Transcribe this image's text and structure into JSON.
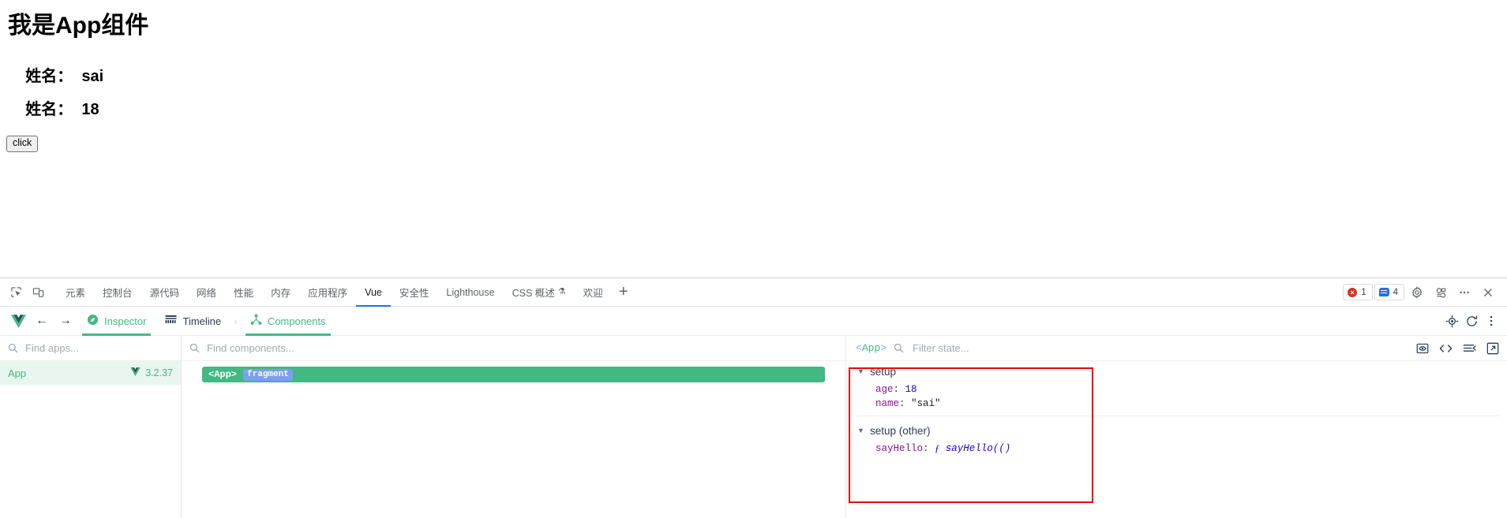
{
  "page": {
    "heading": "我是App组件",
    "rows": [
      {
        "label": "姓名：",
        "value": "sai"
      },
      {
        "label": "姓名：",
        "value": "18"
      }
    ],
    "button_label": "click"
  },
  "devtools": {
    "left_icons": [
      {
        "name": "inspect-element-icon"
      },
      {
        "name": "device-toolbar-icon"
      }
    ],
    "tabs": [
      {
        "label": "元素",
        "active": false
      },
      {
        "label": "控制台",
        "active": false
      },
      {
        "label": "源代码",
        "active": false
      },
      {
        "label": "网络",
        "active": false
      },
      {
        "label": "性能",
        "active": false
      },
      {
        "label": "内存",
        "active": false
      },
      {
        "label": "应用程序",
        "active": false
      },
      {
        "label": "Vue",
        "active": true
      },
      {
        "label": "安全性",
        "active": false
      },
      {
        "label": "Lighthouse",
        "active": false
      },
      {
        "label": "CSS 概述",
        "active": false,
        "flask": "⚗"
      },
      {
        "label": "欢迎",
        "active": false
      }
    ],
    "add_tab_label": "+",
    "errors_count": "1",
    "messages_count": "4",
    "right_icons": [
      {
        "name": "settings-gear-icon"
      },
      {
        "name": "devices-icon"
      },
      {
        "name": "more-options-icon"
      },
      {
        "name": "close-devtools-icon"
      }
    ]
  },
  "vue_bar": {
    "back_label": "←",
    "forward_label": "→",
    "tabs": [
      {
        "label": "Inspector",
        "icon": "compass-icon",
        "active": true
      },
      {
        "label": "Timeline",
        "icon": "timeline-icon",
        "active": false
      },
      {
        "label": "Components",
        "icon": "components-tree-icon",
        "active": true
      }
    ],
    "chevron": "›",
    "right_icons": [
      {
        "name": "select-component-target-icon"
      },
      {
        "name": "refresh-icon"
      },
      {
        "name": "vue-more-menu-icon"
      }
    ]
  },
  "apps_panel": {
    "search_placeholder": "Find apps...",
    "search_value": "",
    "apps": [
      {
        "name": "App",
        "version": "3.2.37",
        "selected": true
      }
    ]
  },
  "tree_panel": {
    "search_placeholder": "Find components...",
    "search_value": "",
    "nodes": [
      {
        "name": "<App>",
        "badge": "fragment",
        "selected": true
      }
    ]
  },
  "state_panel": {
    "component_angle_open": "<",
    "component_name": "App",
    "component_angle_close": ">",
    "filter_placeholder": "Filter state...",
    "filter_value": "",
    "icons": [
      {
        "name": "inspect-dom-icon"
      },
      {
        "name": "open-in-editor-code-icon"
      },
      {
        "name": "console-output-icon"
      },
      {
        "name": "open-external-icon"
      }
    ],
    "groups": [
      {
        "title": "setup",
        "caret": "▼",
        "expanded": true,
        "entries": [
          {
            "key": "age",
            "value": "18",
            "kind": "number"
          },
          {
            "key": "name",
            "value": "\"sai\"",
            "kind": "string"
          }
        ]
      },
      {
        "title": "setup (other)",
        "caret": "▼",
        "expanded": true,
        "entries": [
          {
            "key": "sayHello",
            "value": "sayHello(()",
            "kind": "function",
            "fn_mark": "ƒ"
          }
        ]
      }
    ]
  },
  "annotation": {
    "color": "#ee0000",
    "shape": "rectangle"
  }
}
